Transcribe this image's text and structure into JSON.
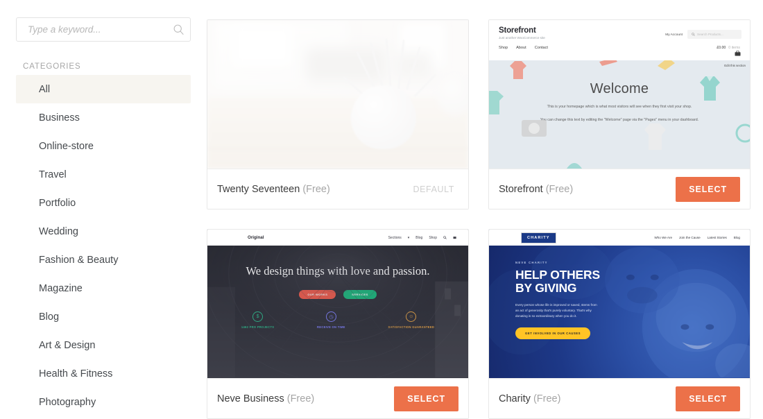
{
  "search": {
    "placeholder": "Type a keyword...",
    "value": "",
    "icon": "search-icon"
  },
  "sidebar": {
    "heading": "CATEGORIES",
    "items": [
      {
        "label": "All",
        "active": true
      },
      {
        "label": "Business",
        "active": false
      },
      {
        "label": "Online-store",
        "active": false
      },
      {
        "label": "Travel",
        "active": false
      },
      {
        "label": "Portfolio",
        "active": false
      },
      {
        "label": "Wedding",
        "active": false
      },
      {
        "label": "Fashion & Beauty",
        "active": false
      },
      {
        "label": "Magazine",
        "active": false
      },
      {
        "label": "Blog",
        "active": false
      },
      {
        "label": "Art & Design",
        "active": false
      },
      {
        "label": "Health & Fitness",
        "active": false
      },
      {
        "label": "Photography",
        "active": false
      }
    ]
  },
  "colors": {
    "accent": "#ec7149",
    "active_row": "#f7f5f0",
    "card_border": "#e8e8e8",
    "storefront_hero": "#e4eaef",
    "neve_dark": "#2a2b34",
    "neve_red": "#f0594a",
    "neve_green": "#18b77c",
    "charity_blue": "#1b3a87",
    "charity_yellow": "#ffc425"
  },
  "themes": [
    {
      "name": "Twenty Seventeen",
      "price": "(Free)",
      "status_label": "DEFAULT",
      "action": null,
      "preview": "plant-photo"
    },
    {
      "name": "Storefront",
      "price": "(Free)",
      "status_label": null,
      "action": "SELECT",
      "preview": "storefront",
      "preview_content": {
        "brand": "Storefront",
        "tagline": "Just another WooCommerce site",
        "nav": [
          "Shop",
          "About",
          "Contact"
        ],
        "account": "My Account",
        "search_placeholder": "Search Products...",
        "cart_total": "£0.00",
        "cart_items": "0 items",
        "edit_link": "Edit this section",
        "heading": "Welcome",
        "paragraph1": "This is your homepage which is what most visitors will see when they first visit your shop.",
        "paragraph2": "You can change this text by editing the \"Welcome\" page via the \"Pages\" menu in your dashboard."
      }
    },
    {
      "name": "Neve Business",
      "price": "(Free)",
      "status_label": null,
      "action": "SELECT",
      "preview": "neve",
      "preview_content": {
        "logo": "Original",
        "nav": [
          "Sections",
          "Blog",
          "Shop"
        ],
        "headline": "We design things with love and passion.",
        "buttons": [
          "OUR WORKS",
          "SERVICES"
        ],
        "features": [
          {
            "icon": "dollar-icon",
            "label": "1462 PRO PROJECTS",
            "color": "#2fae86"
          },
          {
            "icon": "clock-icon",
            "label": "RECEIVE ON TIME",
            "color": "#7b7cf0"
          },
          {
            "icon": "smile-icon",
            "label": "SATISFACTION GUARANTEED",
            "color": "#d79a46"
          }
        ]
      }
    },
    {
      "name": "Charity",
      "price": "(Free)",
      "status_label": null,
      "action": "SELECT",
      "preview": "charity",
      "preview_content": {
        "logo": "CHARITY",
        "nav": [
          "Who We Are",
          "Join the Cause",
          "Latest Stories",
          "Blog"
        ],
        "kicker": "NEVE CHARITY",
        "headline": "HELP OTHERS BY GIVING",
        "paragraph": "Every person whose life is improved or saved, stems from an act of generosity that's purely voluntary. That's why donating is so extraordinary when you do it.",
        "cta": "GET INVOLVED IN OUR CAUSES"
      }
    }
  ]
}
